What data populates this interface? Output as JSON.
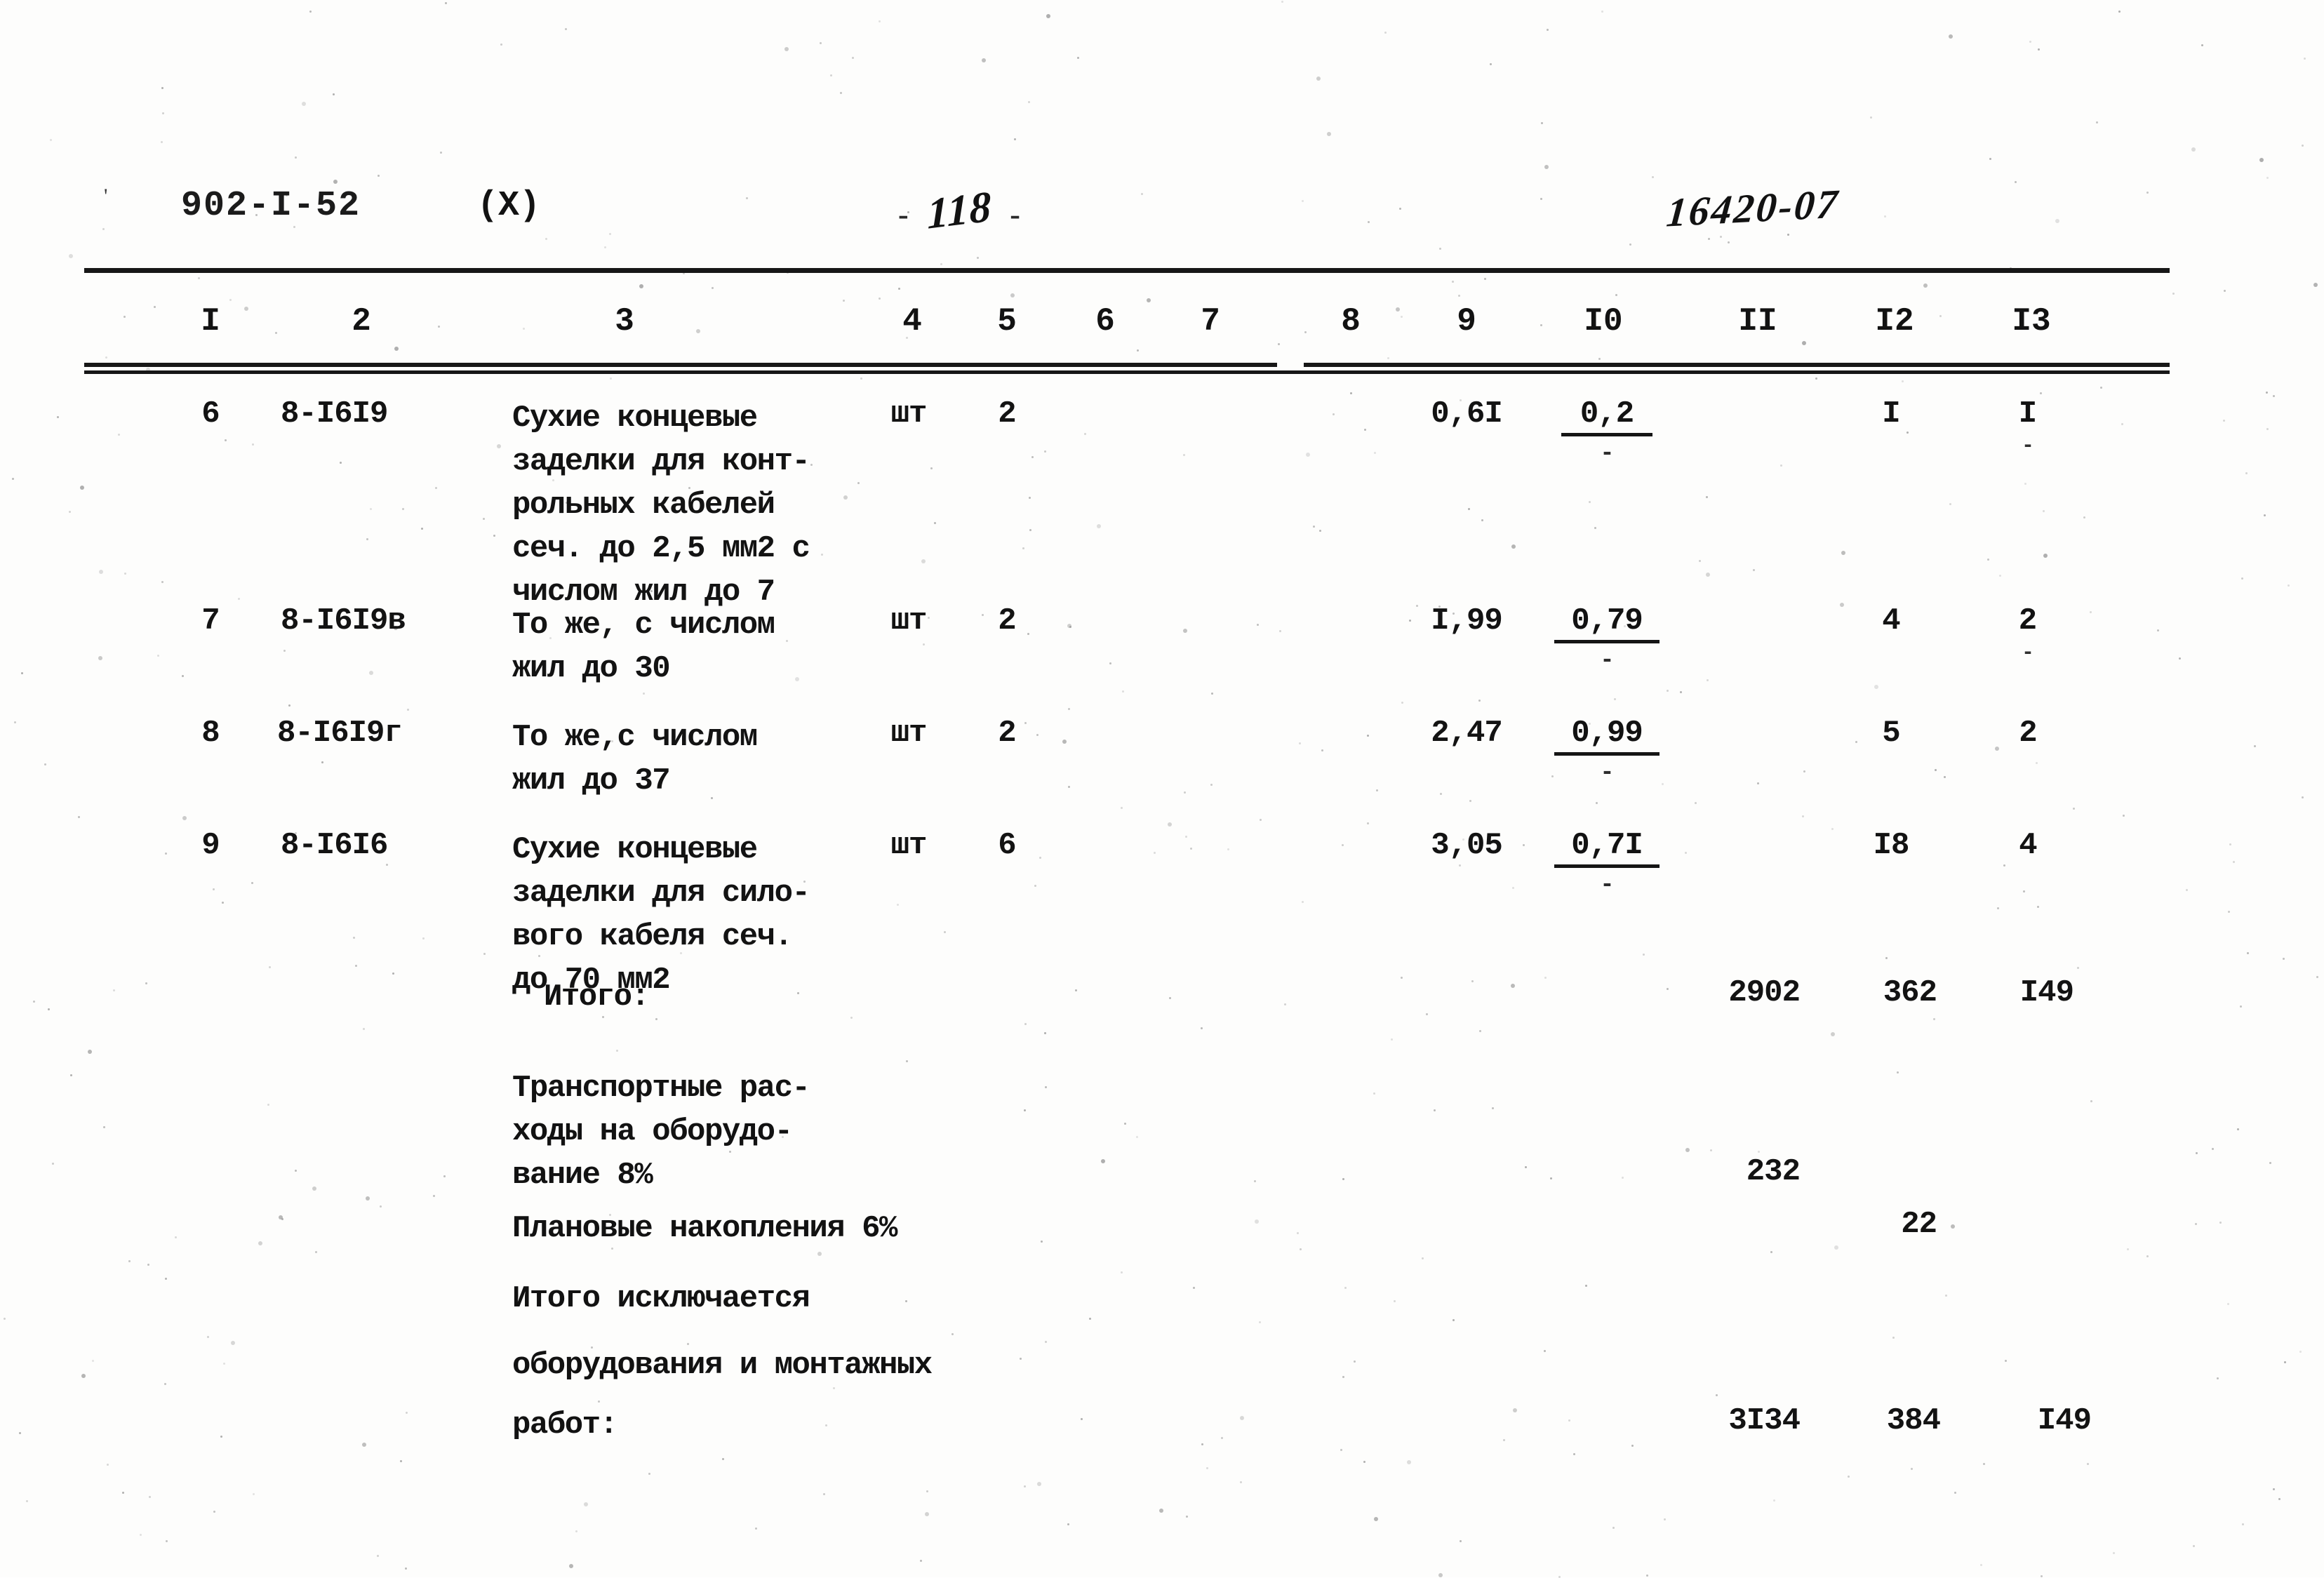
{
  "header": {
    "doc_code": "902-I-52",
    "variant": "(X)",
    "dash_left": "-",
    "dash_right": "-",
    "page_number": "118",
    "sheet_number": "16420-07"
  },
  "table": {
    "column_headers": [
      "I",
      "2",
      "3",
      "4",
      "5",
      "6",
      "7",
      "8",
      "9",
      "I0",
      "II",
      "I2",
      "I3"
    ],
    "rows": [
      {
        "c1": "6",
        "c2": "8-I6I9",
        "c3": "Сухие концевые\nзаделки для конт-\nрольных кабелей\nсеч. до 2,5 мм2 с\nчислом жил до 7",
        "c4": "шт",
        "c5": "2",
        "c6": "",
        "c7": "",
        "c8": "",
        "c9": "0,6I",
        "c10_num": "0,2",
        "c10_den": "-",
        "c11": "",
        "c12": "I",
        "c13_num": "I",
        "c13_den": "-"
      },
      {
        "c1": "7",
        "c2": "8-I6I9в",
        "c3": "То же, с числом\nжил до 30",
        "c4": "шт",
        "c5": "2",
        "c6": "",
        "c7": "",
        "c8": "",
        "c9": "I,99",
        "c10_num": "0,79",
        "c10_den": "-",
        "c11": "",
        "c12": "4",
        "c13_num": "2",
        "c13_den": "-"
      },
      {
        "c1": "8",
        "c2": "8-I6I9г",
        "c3": "То же,с числом\nжил до 37",
        "c4": "шт",
        "c5": "2",
        "c6": "",
        "c7": "",
        "c8": "",
        "c9": "2,47",
        "c10_num": "0,99",
        "c10_den": "-",
        "c11": "",
        "c12": "5",
        "c13_num": "2",
        "c13_den": ""
      },
      {
        "c1": "9",
        "c2": "8-I6I6",
        "c3": "Сухие концевые\nзаделки для сило-\nвого кабеля сеч.\nдо 70 мм2",
        "c4": "шт",
        "c5": "6",
        "c6": "",
        "c7": "",
        "c8": "",
        "c9": "3,05",
        "c10_num": "0,7I",
        "c10_den": "-",
        "c11": "",
        "c12": "I8",
        "c13_num": "4",
        "c13_den": ""
      }
    ],
    "summary": [
      {
        "label": "Итого:",
        "c11": "2902",
        "c12": "362",
        "c13": "I49"
      },
      {
        "label": "Транспортные рас-\nходы на оборудо-\nвание 8%",
        "c11": "232",
        "c12": "",
        "c13": ""
      },
      {
        "label": "Плановые накопления 6%",
        "c11": "",
        "c12": "22",
        "c13": ""
      },
      {
        "label": "Итого исключается",
        "c11": "",
        "c12": "",
        "c13": ""
      },
      {
        "label": "оборудования и монтажных",
        "c11": "",
        "c12": "",
        "c13": ""
      },
      {
        "label": "работ:",
        "c11": "3I34",
        "c12": "384",
        "c13": "I49"
      }
    ]
  }
}
